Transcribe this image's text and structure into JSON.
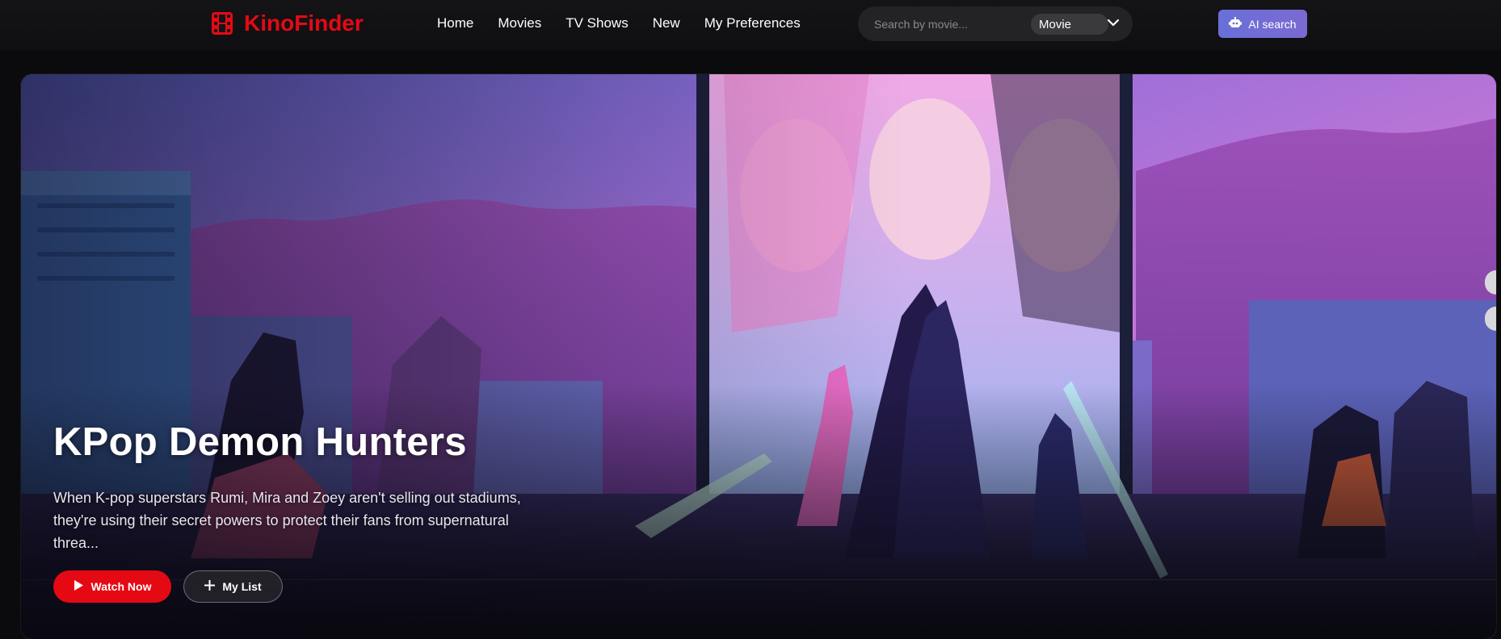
{
  "brand": {
    "name": "KinoFinder",
    "color": "#e50914",
    "icon": "film-icon"
  },
  "nav": {
    "items": [
      {
        "label": "Home"
      },
      {
        "label": "Movies"
      },
      {
        "label": "TV Shows"
      },
      {
        "label": "New"
      },
      {
        "label": "My Preferences"
      }
    ]
  },
  "search": {
    "placeholder": "Search by movie...",
    "value": "",
    "type_selected": "Movie",
    "dropdown_icon": "chevron-down-icon"
  },
  "ai_search": {
    "label": "AI search",
    "icon": "robot-icon",
    "color": "#6a6fd8"
  },
  "hero": {
    "title": "KPop Demon Hunters",
    "description": "When K-pop superstars Rumi, Mira and Zoey aren't selling out stadiums, they're using their secret powers to protect their fans from supernatural threa...",
    "primary_button": {
      "label": "Watch Now",
      "icon": "play-icon",
      "color": "#e50914"
    },
    "secondary_button": {
      "label": "My List",
      "icon": "plus-icon"
    }
  }
}
